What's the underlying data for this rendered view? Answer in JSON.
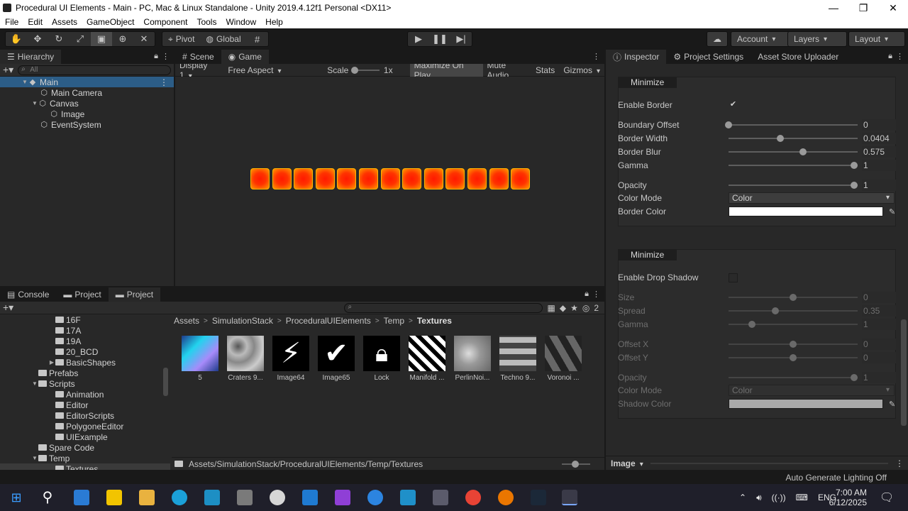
{
  "window": {
    "title": "Procedural UI Elements - Main - PC, Mac & Linux Standalone - Unity 2019.4.12f1 Personal <DX11>",
    "controls": [
      "—",
      "❐",
      "✕"
    ]
  },
  "menu": [
    "File",
    "Edit",
    "Assets",
    "GameObject",
    "Component",
    "Tools",
    "Window",
    "Help"
  ],
  "toolbar": {
    "pivot": "Pivot",
    "global": "Global",
    "account": "Account",
    "layers": "Layers",
    "layout": "Layout"
  },
  "hierarchy": {
    "tab": "Hierarchy",
    "search_placeholder": "All",
    "items": [
      {
        "label": "Main",
        "depth": 0
      },
      {
        "label": "Main Camera",
        "depth": 1
      },
      {
        "label": "Canvas",
        "depth": 1
      },
      {
        "label": "Image",
        "depth": 2
      },
      {
        "label": "EventSystem",
        "depth": 1
      }
    ]
  },
  "game": {
    "tabs": [
      "Scene",
      "Game"
    ],
    "display": "Display 1",
    "aspect": "Free Aspect",
    "scale_label": "Scale",
    "scale_value": "1x",
    "maximize": "Maximize On Play",
    "mute": "Mute Audio",
    "stats": "Stats",
    "gizmos": "Gizmos",
    "tile_count": 13
  },
  "project": {
    "tabs": [
      "Console",
      "Project",
      "Project"
    ],
    "badge": "2",
    "tree": [
      {
        "label": "16F",
        "depth": 2
      },
      {
        "label": "17A",
        "depth": 2
      },
      {
        "label": "19A",
        "depth": 2
      },
      {
        "label": "20_BCD",
        "depth": 2
      },
      {
        "label": "BasicShapes",
        "depth": 2
      },
      {
        "label": "Prefabs",
        "depth": 1
      },
      {
        "label": "Scripts",
        "depth": 1
      },
      {
        "label": "Animation",
        "depth": 2
      },
      {
        "label": "Editor",
        "depth": 2
      },
      {
        "label": "EditorScripts",
        "depth": 2
      },
      {
        "label": "PolygoneEditor",
        "depth": 2
      },
      {
        "label": "UIExample",
        "depth": 2
      },
      {
        "label": "Spare Code",
        "depth": 1
      },
      {
        "label": "Temp",
        "depth": 1
      },
      {
        "label": "Textures",
        "depth": 2
      }
    ],
    "breadcrumb": [
      "Assets",
      "SimulationStack",
      "ProceduralUIElements",
      "Temp",
      "Textures"
    ],
    "assets": [
      "5",
      "Craters 9...",
      "Image64",
      "Image65",
      "Lock",
      "Manifold ...",
      "PerlinNoi...",
      "Techno 9...",
      "Voronoi ..."
    ],
    "path": "Assets/SimulationStack/ProceduralUIElements/Temp/Textures"
  },
  "inspector": {
    "tabs": [
      "Inspector",
      "Project Settings",
      "Asset Store Uploader"
    ],
    "border": {
      "header": "Minimize",
      "enable_label": "Enable Border",
      "enable_value": "✔",
      "rows": [
        {
          "label": "Boundary Offset",
          "value": "0",
          "fraction": 0.0
        },
        {
          "label": "Border Width",
          "value": "0.0404",
          "fraction": 0.4
        },
        {
          "label": "Border Blur",
          "value": "0.575",
          "fraction": 0.575
        },
        {
          "label": "Gamma",
          "value": "1",
          "fraction": 0.97
        },
        {
          "label": "Opacity",
          "value": "1",
          "fraction": 0.97
        }
      ],
      "color_mode_label": "Color Mode",
      "color_mode_value": "Color",
      "color_label": "Border Color",
      "color_value": "#ffffff"
    },
    "shadow": {
      "header": "Minimize",
      "enable_label": "Enable Drop Shadow",
      "enable_value": "",
      "rows": [
        {
          "label": "Size",
          "value": "0",
          "fraction": 0.5
        },
        {
          "label": "Spread",
          "value": "0.35",
          "fraction": 0.36
        },
        {
          "label": "Gamma",
          "value": "1",
          "fraction": 0.18
        },
        {
          "label": "Offset X",
          "value": "0",
          "fraction": 0.5
        },
        {
          "label": "Offset Y",
          "value": "0",
          "fraction": 0.5
        },
        {
          "label": "Opacity",
          "value": "1",
          "fraction": 0.97
        }
      ],
      "color_mode_label": "Color Mode",
      "color_mode_value": "Color",
      "color_label": "Shadow Color",
      "color_value": "#a9a9a9"
    },
    "footer": "Image"
  },
  "status": {
    "message": "Auto Generate Lighting Off"
  },
  "taskbar": {
    "language": "ENG",
    "time": "7:00 AM",
    "date": "6/12/2025"
  }
}
